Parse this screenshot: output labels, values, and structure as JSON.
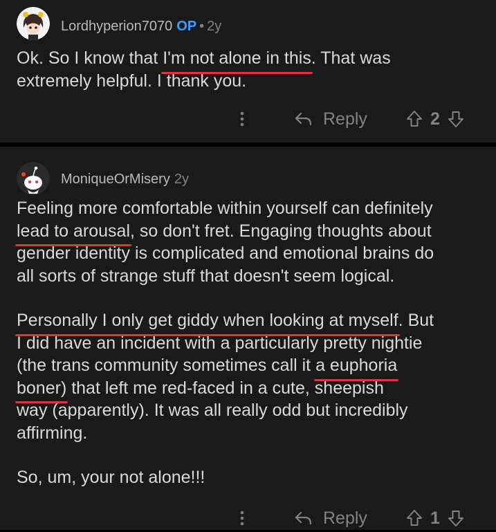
{
  "comments": [
    {
      "username": "Lordhyperion7070",
      "op_badge": "OP",
      "separator": "•",
      "age": "2y",
      "body_lines": [
        [
          {
            "t": "Ok. So I know that "
          },
          {
            "t": "I'm not alone in this",
            "mark": true
          },
          {
            "t": ". That was"
          }
        ],
        [
          {
            "t": "extremely helpful. I thank you."
          }
        ]
      ],
      "reply_label": "Reply",
      "vote_count": "2",
      "avatar_icon": "anime-avatar-icon"
    },
    {
      "username": "MoniqueOrMisery",
      "age": "2y",
      "paragraphs": [
        [
          [
            {
              "t": "Feeling more comfortable within yourself can definitely"
            }
          ],
          [
            {
              "t": "lead to arousal",
              "mark": true
            },
            {
              "t": ", so don't fret. Engaging thoughts about"
            }
          ],
          [
            {
              "t": "gender identity is complicated and emotional brains do"
            }
          ],
          [
            {
              "t": "all sorts of strange stuff that doesn't seem logical."
            }
          ]
        ],
        [
          [
            {
              "t": "Personally I only get giddy when looking at myself",
              "mark": true
            },
            {
              "t": ". But"
            }
          ],
          [
            {
              "t": "I did have an incident with a particularly pretty nightie"
            }
          ],
          [
            {
              "t": "(the trans community sometimes call it "
            },
            {
              "t": "a euphoria",
              "mark": true
            }
          ],
          [
            {
              "t": "boner)",
              "mark": true
            },
            {
              "t": " that left me red-faced in a cute, sheepish"
            }
          ],
          [
            {
              "t": "way (apparently). It was all really odd but incredibly"
            }
          ],
          [
            {
              "t": "affirming."
            }
          ]
        ],
        [
          [
            {
              "t": "So, um, your not alone!!!"
            }
          ]
        ]
      ],
      "reply_label": "Reply",
      "vote_count": "1",
      "avatar_icon": "snoo-avatar-icon"
    }
  ],
  "colors": {
    "background": "#000000",
    "card": "#1a1a1b",
    "text": "#d7dadc",
    "muted": "#818384",
    "op_badge": "#3d9dff",
    "underline_mark": "#e0333a"
  }
}
